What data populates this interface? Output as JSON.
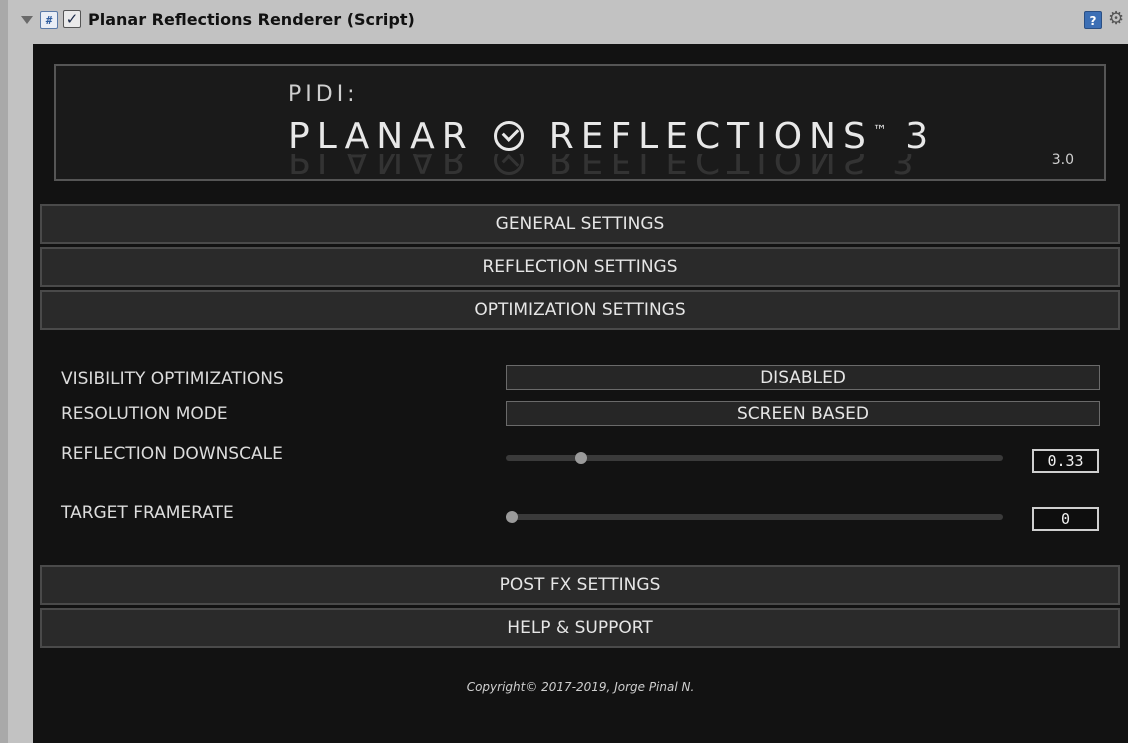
{
  "component": {
    "title": "Planar Reflections Renderer (Script)",
    "enabled": true,
    "script_icon": "script-icon",
    "help_icon": "help-icon",
    "gear_icon": "gear-icon"
  },
  "logo": {
    "pidi": "PIDI:",
    "product_left": "PLANAR",
    "product_right": "REFLECTIONS",
    "trademark": "™",
    "product_number": "3",
    "version": "3.0"
  },
  "sections": {
    "general": "GENERAL SETTINGS",
    "reflection": "REFLECTION SETTINGS",
    "optimization": "OPTIMIZATION SETTINGS",
    "post_fx": "POST FX SETTINGS",
    "help": "HELP & SUPPORT"
  },
  "optimization": {
    "visibility_label": "VISIBILITY OPTIMIZATIONS",
    "visibility_value": "DISABLED",
    "resolution_label": "RESOLUTION MODE",
    "resolution_value": "SCREEN BASED",
    "downscale_label": "REFLECTION DOWNSCALE",
    "downscale_value": "0.33",
    "downscale_fraction": 0.15,
    "framerate_label": "TARGET FRAMERATE",
    "framerate_value": "0",
    "framerate_fraction": 0.0
  },
  "footer": {
    "copyright": "Copyright© 2017-2019,   Jorge Pinal N."
  }
}
